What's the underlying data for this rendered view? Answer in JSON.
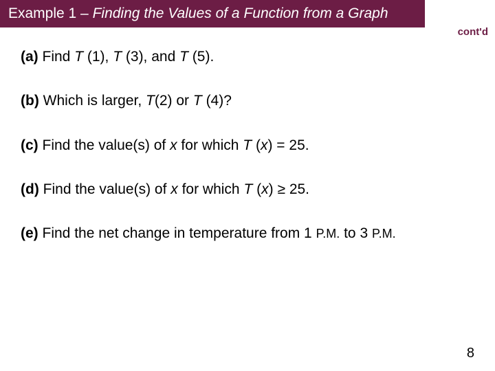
{
  "header": {
    "prefix": "Example 1 – ",
    "title_italic": "Finding the Values of a Function from a Graph"
  },
  "contd": "cont'd",
  "items": {
    "a": {
      "label": "(a)",
      "pre": " Find ",
      "t1": "T ",
      "p1": "(1), ",
      "t2": "T ",
      "p2": "(3), and ",
      "t3": "T ",
      "p3": "(5)."
    },
    "b": {
      "label": "(b)",
      "pre": " Which is larger, ",
      "t1": "T",
      "p1": "(2) or ",
      "t2": "T ",
      "p2": "(4)?"
    },
    "c": {
      "label": "(c)",
      "pre": " Find the value(s) of ",
      "x1": "x",
      "mid": " for which ",
      "t1": "T ",
      "open": "(",
      "x2": "x",
      "close": ") = 25."
    },
    "d": {
      "label": "(d)",
      "pre": " Find the value(s) of ",
      "x1": "x",
      "mid": " for which ",
      "t1": "T ",
      "open": "(",
      "x2": "x",
      "close": ") ",
      "ge": "≥",
      "val": " 25."
    },
    "e": {
      "label": "(e)",
      "pre": " Find the net change in temperature from 1 ",
      "pm1": "P.M.",
      "mid": " to 3 ",
      "pm2": "P.M."
    }
  },
  "page_number": "8"
}
